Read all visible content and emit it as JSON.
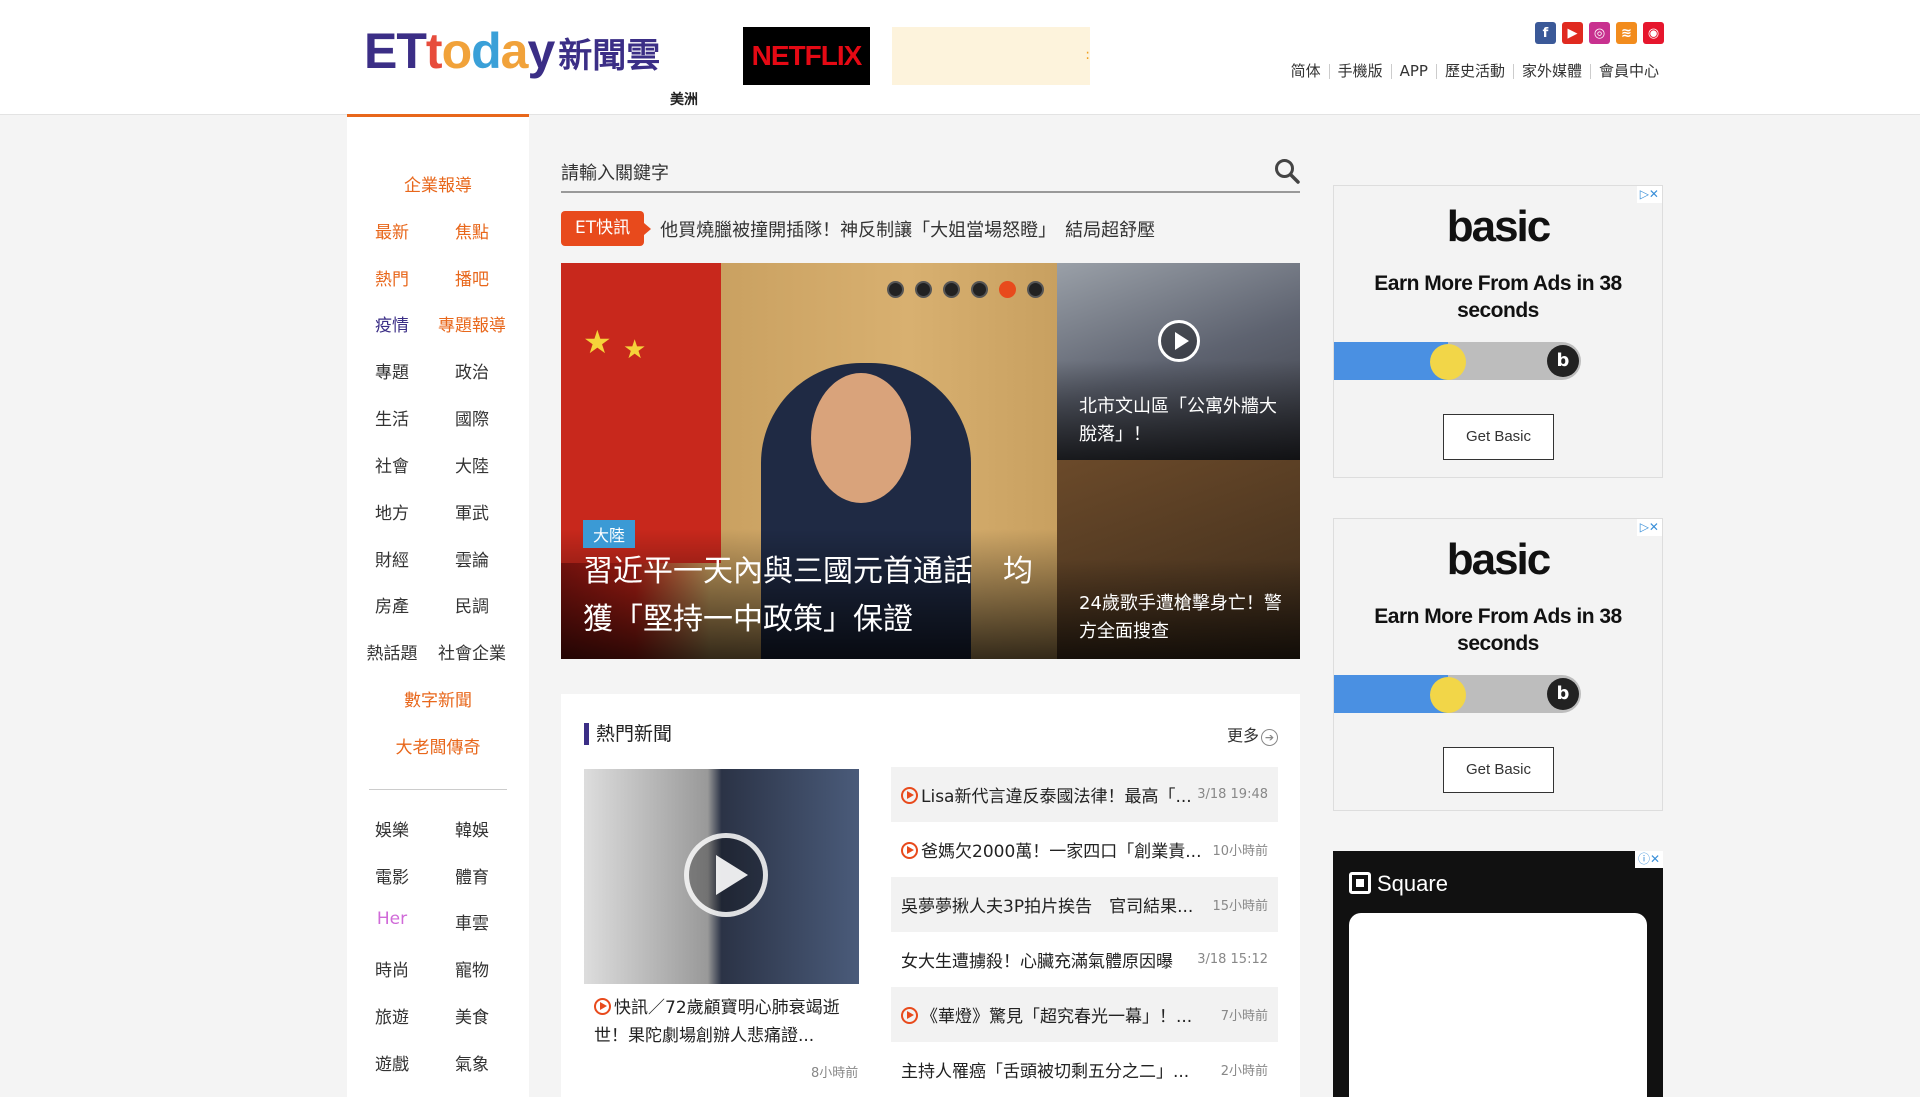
{
  "header": {
    "logo_text": "ETtoday",
    "logo_suffix": "新聞雲",
    "region": "美洲",
    "netflix_label": "NETFLIX",
    "social_icons": [
      "facebook-icon",
      "youtube-icon",
      "instagram-icon",
      "rss-icon",
      "weibo-icon"
    ],
    "nav": [
      "简体",
      "手機版",
      "APP",
      "歷史活動",
      "家外媒體",
      "會員中心"
    ]
  },
  "sidebar": {
    "top_center": "企業報導",
    "pairs": [
      [
        "最新",
        "焦點"
      ],
      [
        "熱門",
        "播吧"
      ],
      [
        "疫情",
        "專題報導"
      ],
      [
        "專題",
        "政治"
      ],
      [
        "生活",
        "國際"
      ],
      [
        "社會",
        "大陸"
      ],
      [
        "地方",
        "軍武"
      ],
      [
        "財經",
        "雲論"
      ],
      [
        "房產",
        "民調"
      ],
      [
        "熱話題",
        "社會企業"
      ]
    ],
    "center_items": [
      "數字新聞",
      "大老闆傳奇"
    ],
    "pairs2": [
      [
        "娛樂",
        "韓娛"
      ],
      [
        "電影",
        "體育"
      ],
      [
        "Her",
        "車雲"
      ],
      [
        "時尚",
        "寵物"
      ],
      [
        "旅遊",
        "美食"
      ],
      [
        "遊戲",
        "氣象"
      ]
    ]
  },
  "search": {
    "placeholder": "請輸入關鍵字"
  },
  "breaking": {
    "tag": "ET快訊",
    "text": "他買燒臘被撞開插隊！神反制讓「大姐當場怒瞪」　結局超舒壓"
  },
  "hero": {
    "category": "大陸",
    "title": "習近平一天內與三國元首通話　均獲「堅持一中政策」保證",
    "dot_count": 6,
    "active_dot": 5
  },
  "side_stories": [
    {
      "title": "北市文山區「公寓外牆大脫落」！"
    },
    {
      "title": "24歲歌手遭槍擊身亡！警方全面搜查"
    }
  ],
  "hot": {
    "heading": "熱門新聞",
    "more": "更多",
    "feature_caption": "快訊／72歲顧寶明心肺衰竭逝世！果陀劇場創辦人悲痛證...",
    "feature_time": "8小時前",
    "items": [
      {
        "title": "Lisa新代言違反泰國法律！最高「...",
        "time": "3/18 19:48",
        "video": true
      },
      {
        "title": "爸媽欠2000萬！一家四口「創業責...",
        "time": "10小時前",
        "video": true
      },
      {
        "title": "吳夢夢揪人夫3P拍片挨告　官司結果...",
        "time": "15小時前",
        "video": false
      },
      {
        "title": "女大生遭擄殺！心臟充滿氣體原因曝",
        "time": "3/18 15:12",
        "video": false
      },
      {
        "title": "《華燈》驚見「超究春光一幕」！...",
        "time": "7小時前",
        "video": true
      },
      {
        "title": "主持人罹癌「舌頭被切剩五分之二」...",
        "time": "2小時前",
        "video": false
      }
    ]
  },
  "ads": [
    {
      "logo": "basic",
      "headline": "Earn More From Ads in 38 seconds",
      "button": "Get Basic",
      "progress": 0.46
    },
    {
      "logo": "basic",
      "headline": "Earn More From Ads in 38 seconds",
      "button": "Get Basic",
      "progress": 0.46
    }
  ],
  "ad3": {
    "brand": "Square"
  }
}
